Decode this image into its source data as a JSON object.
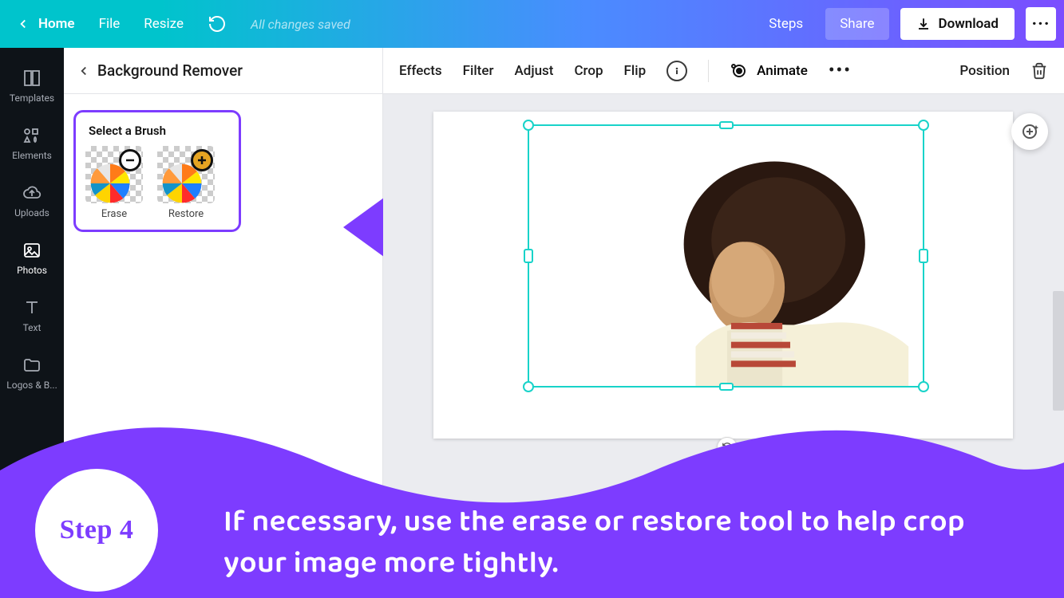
{
  "topbar": {
    "home": "Home",
    "file": "File",
    "resize": "Resize",
    "status": "All changes saved",
    "steps": "Steps",
    "share": "Share",
    "download": "Download"
  },
  "sidebar": {
    "items": [
      {
        "label": "Templates"
      },
      {
        "label": "Elements"
      },
      {
        "label": "Uploads"
      },
      {
        "label": "Photos"
      },
      {
        "label": "Text"
      },
      {
        "label": "Logos & B..."
      }
    ],
    "active_index": 3
  },
  "panel": {
    "title": "Background Remover",
    "brush_heading": "Select a Brush",
    "brush_erase": "Erase",
    "brush_restore": "Restore"
  },
  "toolbar": {
    "effects": "Effects",
    "filter": "Filter",
    "adjust": "Adjust",
    "crop": "Crop",
    "flip": "Flip",
    "animate": "Animate",
    "position": "Position"
  },
  "annotation": {
    "step_label": "Step 4",
    "step_text": "If necessary, use the erase or restore tool to help crop your image more tightly."
  },
  "colors": {
    "accent": "#7d3cff",
    "selection": "#18d3c9"
  }
}
